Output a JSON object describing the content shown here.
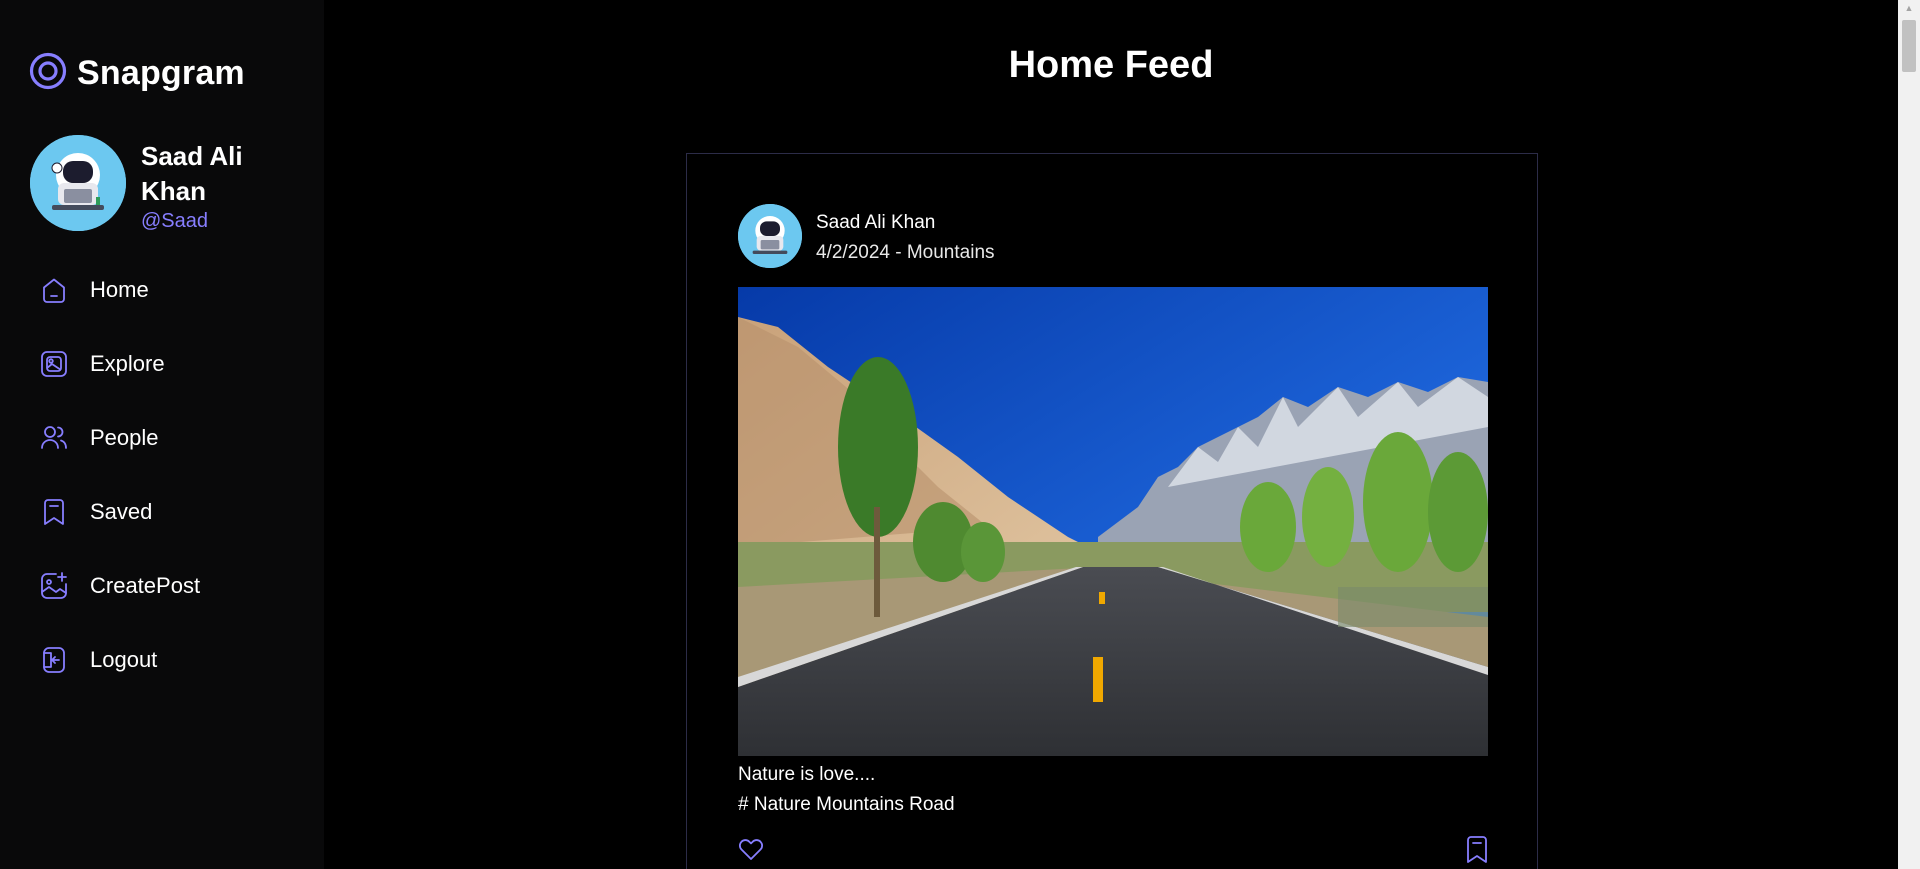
{
  "app": {
    "name": "Snapgram"
  },
  "colors": {
    "accent": "#877eff",
    "background": "#000000",
    "sidebar": "#09090a"
  },
  "user": {
    "name": "Saad Ali Khan",
    "handle": "@Saad"
  },
  "nav": [
    {
      "label": "Home",
      "icon": "home-icon"
    },
    {
      "label": "Explore",
      "icon": "gallery-icon"
    },
    {
      "label": "People",
      "icon": "people-icon"
    },
    {
      "label": "Saved",
      "icon": "bookmark-icon"
    },
    {
      "label": "CreatePost",
      "icon": "add-image-icon"
    },
    {
      "label": "Logout",
      "icon": "logout-icon"
    }
  ],
  "page": {
    "title": "Home Feed"
  },
  "post": {
    "author": "Saad Ali Khan",
    "date": "4/2/2024",
    "location": "Mountains",
    "date_location": "4/2/2024 - Mountains",
    "caption": "Nature is love....",
    "tags": "# Nature Mountains Road"
  }
}
